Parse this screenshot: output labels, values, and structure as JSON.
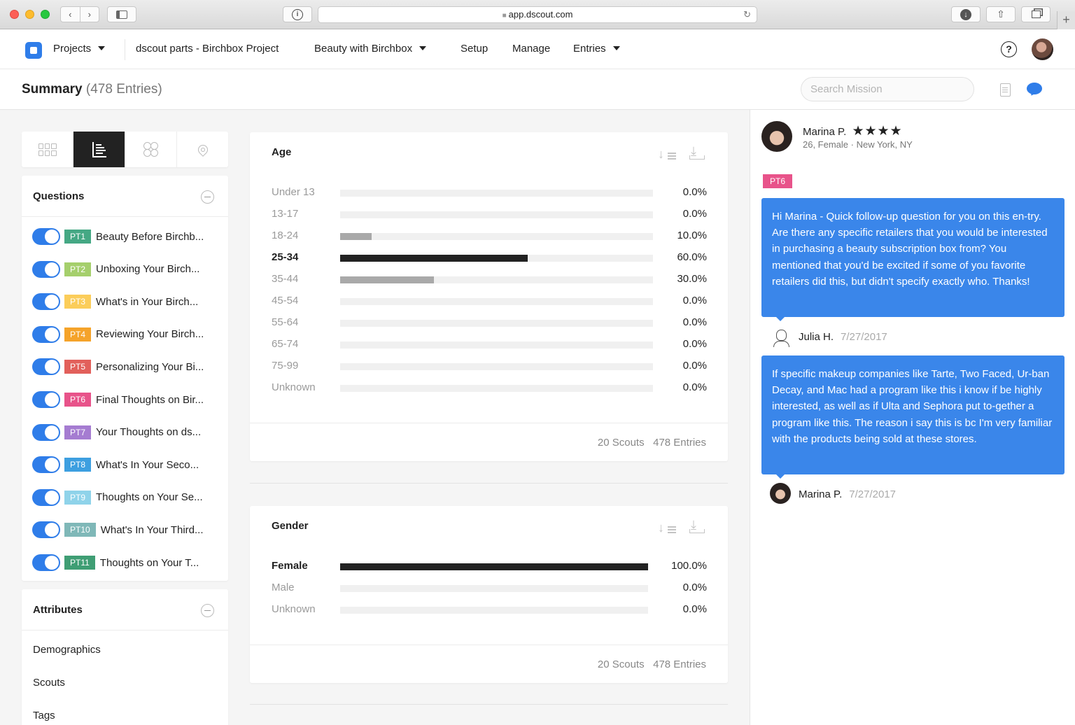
{
  "browser": {
    "url": "app.dscout.com",
    "back": "‹",
    "forward": "›"
  },
  "nav": {
    "projects": "Projects",
    "project_name": "dscout parts - Birchbox Project",
    "mission": "Beauty with Birchbox",
    "setup": "Setup",
    "manage": "Manage",
    "entries": "Entries",
    "help": "?"
  },
  "summary": {
    "title": "Summary",
    "count": "(478 Entries)",
    "search_placeholder": "Search Mission"
  },
  "questions": {
    "heading": "Questions",
    "items": [
      {
        "tag": "PT1",
        "label": "Beauty Before Birchb...",
        "color": "#45a884"
      },
      {
        "tag": "PT2",
        "label": "Unboxing Your Birch...",
        "color": "#a5cf6c"
      },
      {
        "tag": "PT3",
        "label": "What's in Your Birch...",
        "color": "#fbcd5a"
      },
      {
        "tag": "PT4",
        "label": "Reviewing Your Birch...",
        "color": "#f5a32a"
      },
      {
        "tag": "PT5",
        "label": "Personalizing Your Bi...",
        "color": "#e2605b"
      },
      {
        "tag": "PT6",
        "label": "Final Thoughts on Bir...",
        "color": "#e8538a"
      },
      {
        "tag": "PT7",
        "label": "Your Thoughts on ds...",
        "color": "#a57cd1"
      },
      {
        "tag": "PT8",
        "label": "What's In Your Seco...",
        "color": "#3d9fe0"
      },
      {
        "tag": "PT9",
        "label": "Thoughts on Your Se...",
        "color": "#8fd3ea"
      },
      {
        "tag": "PT10",
        "label": "What's In Your Third...",
        "color": "#7fb8b8"
      },
      {
        "tag": "PT11",
        "label": "Thoughts on Your T...",
        "color": "#3f9e74"
      }
    ]
  },
  "attributes": {
    "heading": "Attributes",
    "items": [
      "Demographics",
      "Scouts",
      "Tags"
    ]
  },
  "chart_data": [
    {
      "type": "bar",
      "title": "Age",
      "categories": [
        "Under 13",
        "13-17",
        "18-24",
        "25-34",
        "35-44",
        "45-54",
        "55-64",
        "65-74",
        "75-99",
        "Unknown"
      ],
      "values": [
        0.0,
        0.0,
        10.0,
        60.0,
        30.0,
        0.0,
        0.0,
        0.0,
        0.0,
        0.0
      ],
      "labels": [
        "0.0%",
        "0.0%",
        "10.0%",
        "60.0%",
        "30.0%",
        "0.0%",
        "0.0%",
        "0.0%",
        "0.0%",
        "0.0%"
      ],
      "highlight": "25-34",
      "xlim": [
        0,
        100
      ],
      "footer": {
        "scouts": "20 Scouts",
        "entries": "478 Entries"
      }
    },
    {
      "type": "bar",
      "title": "Gender",
      "categories": [
        "Female",
        "Male",
        "Unknown"
      ],
      "values": [
        100.0,
        0.0,
        0.0
      ],
      "labels": [
        "100.0%",
        "0.0%",
        "0.0%"
      ],
      "highlight": "Female",
      "xlim": [
        0,
        100
      ],
      "footer": {
        "scouts": "20 Scouts",
        "entries": "478 Entries"
      }
    }
  ],
  "entry": {
    "scout_name": "Marina P.",
    "stars": "★★★★",
    "scout_meta": "26, Female · New York, NY",
    "part_tag": "PT6",
    "messages": [
      {
        "text": "Hi Marina - Quick follow-up question for you on this en-try. Are there any specific retailers that you would be interested in purchasing a beauty subscription box from? You mentioned that you'd be excited if some of you favorite retailers did this, but didn't specify exactly who. Thanks!",
        "author": "Julia H.",
        "date": "7/27/2017"
      },
      {
        "text": "If specific makeup companies like Tarte, Two Faced, Ur-ban Decay, and Mac had a program like this i know if be highly interested, as well as if Ulta and Sephora put to-gether a program like this. The reason i say this is bc I'm very familiar with the products being sold at these stores.",
        "author": "Marina P.",
        "date": "7/27/2017"
      }
    ]
  },
  "colors": {
    "accent": "#2f7de9",
    "bubble": "#3a86ea",
    "bar_dark": "#222222",
    "bar_light": "#a9a9a9"
  }
}
